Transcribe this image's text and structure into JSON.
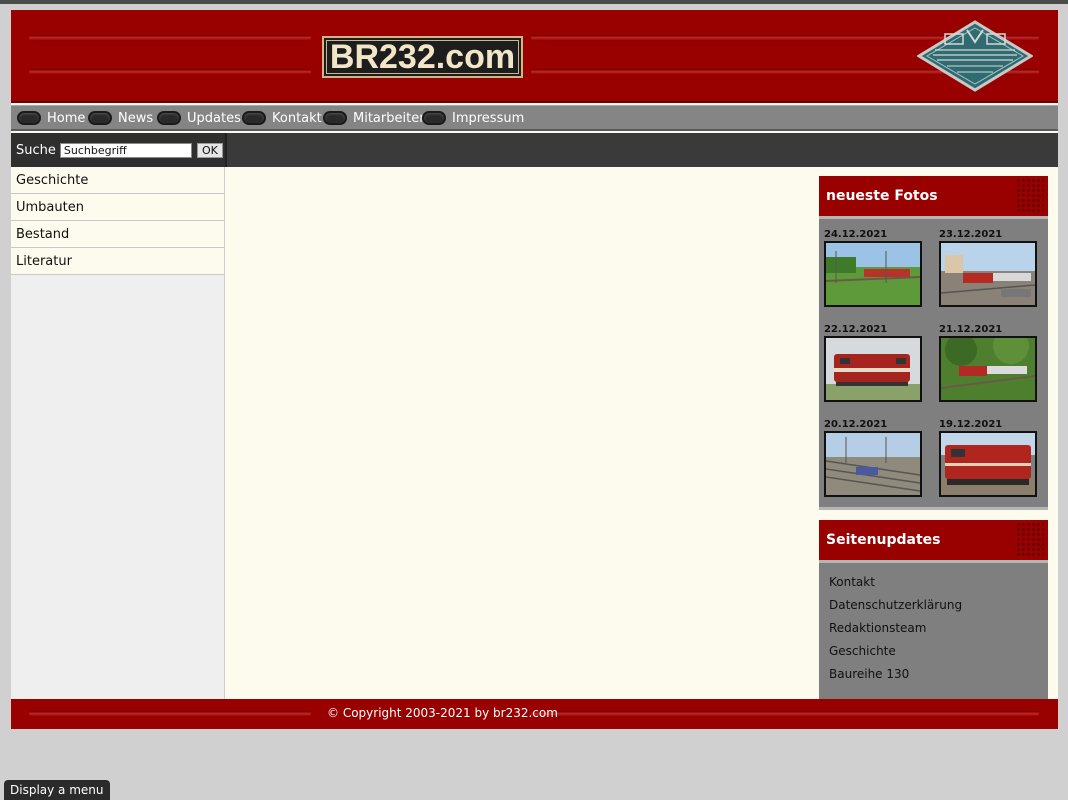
{
  "site": {
    "logo_text": "BR232.com"
  },
  "nav": {
    "items": [
      {
        "label": "Home"
      },
      {
        "label": "News"
      },
      {
        "label": "Updates"
      },
      {
        "label": "Kontakt"
      },
      {
        "label": "Mitarbeiter"
      },
      {
        "label": "Impressum"
      }
    ]
  },
  "search": {
    "label": "Suche",
    "value": "Suchbegriff",
    "button": "OK"
  },
  "sidebar": {
    "items": [
      {
        "label": "Geschichte"
      },
      {
        "label": "Umbauten"
      },
      {
        "label": "Bestand"
      },
      {
        "label": "Literatur"
      }
    ]
  },
  "photos_box": {
    "title": "neueste Fotos",
    "photos": [
      {
        "date": "24.12.2021"
      },
      {
        "date": "23.12.2021"
      },
      {
        "date": "22.12.2021"
      },
      {
        "date": "21.12.2021"
      },
      {
        "date": "20.12.2021"
      },
      {
        "date": "19.12.2021"
      }
    ]
  },
  "updates_box": {
    "title": "Seitenupdates",
    "items": [
      {
        "label": "Kontakt"
      },
      {
        "label": "Datenschutzerklärung"
      },
      {
        "label": "Redaktionsteam"
      },
      {
        "label": "Geschichte"
      },
      {
        "label": "Baureihe 130"
      }
    ]
  },
  "footer": {
    "copyright": "© Copyright 2003-2021 by br232.com"
  },
  "browser": {
    "menu_tip": "Display a menu"
  },
  "colors": {
    "brand_red": "#990000",
    "nav_gray": "#858585",
    "content_bg": "#fdfbee"
  }
}
